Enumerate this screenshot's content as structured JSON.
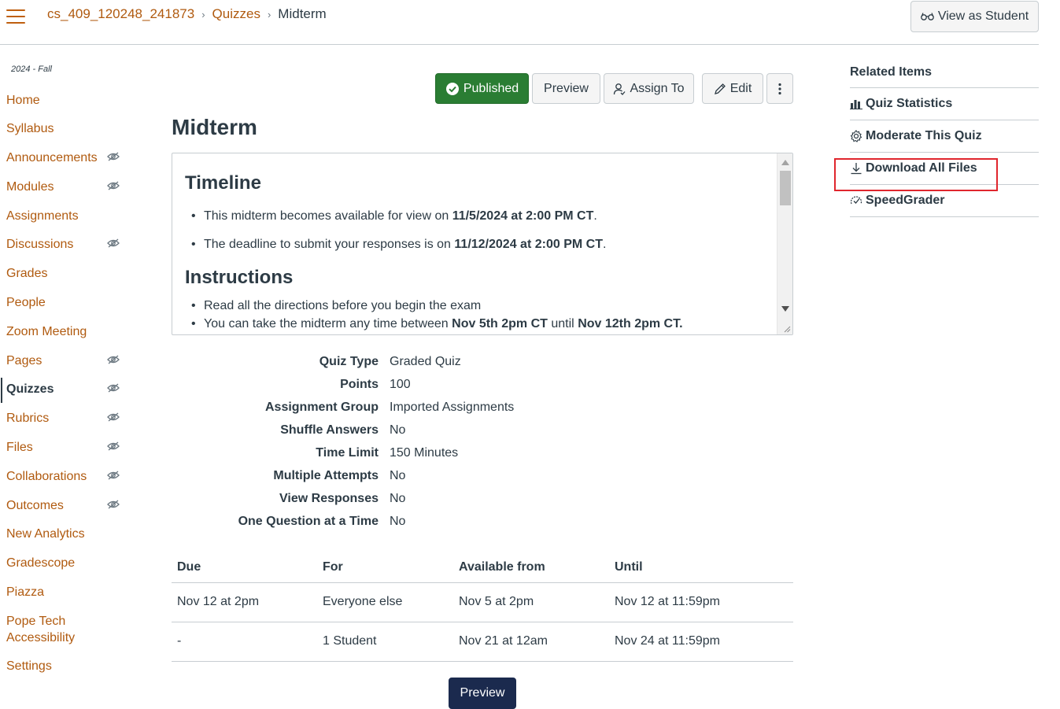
{
  "header": {
    "breadcrumb": [
      "cs_409_120248_241873",
      "Quizzes",
      "Midterm"
    ],
    "view_as_student": "View as Student"
  },
  "nav": {
    "term": "2024 - Fall",
    "items": [
      {
        "label": "Home",
        "hidden": false
      },
      {
        "label": "Syllabus",
        "hidden": false
      },
      {
        "label": "Announcements",
        "hidden": true
      },
      {
        "label": "Modules",
        "hidden": true
      },
      {
        "label": "Assignments",
        "hidden": false
      },
      {
        "label": "Discussions",
        "hidden": true
      },
      {
        "label": "Grades",
        "hidden": false
      },
      {
        "label": "People",
        "hidden": false
      },
      {
        "label": "Zoom Meeting",
        "hidden": false
      },
      {
        "label": "Pages",
        "hidden": true
      },
      {
        "label": "Quizzes",
        "hidden": true,
        "active": true
      },
      {
        "label": "Rubrics",
        "hidden": true
      },
      {
        "label": "Files",
        "hidden": true
      },
      {
        "label": "Collaborations",
        "hidden": true
      },
      {
        "label": "Outcomes",
        "hidden": true
      },
      {
        "label": "New Analytics",
        "hidden": false
      },
      {
        "label": "Gradescope",
        "hidden": false
      },
      {
        "label": "Piazza",
        "hidden": false
      },
      {
        "label": "Pope Tech",
        "label2": "Accessibility",
        "hidden": false
      },
      {
        "label": "Settings",
        "hidden": false
      }
    ]
  },
  "toolbar": {
    "published": "Published",
    "preview": "Preview",
    "assign_to": "Assign To",
    "edit": "Edit"
  },
  "quiz": {
    "title": "Midterm",
    "description": {
      "timeline_heading": "Timeline",
      "timeline_1_pre": "This midterm becomes available for view on ",
      "timeline_1_bold": "11/5/2024 at 2:00 PM CT",
      "timeline_1_post": ".",
      "timeline_2_pre": "The deadline to submit your responses is on ",
      "timeline_2_bold": "11/12/2024 at 2:00 PM CT",
      "timeline_2_post": ".",
      "instructions_heading": "Instructions",
      "instr_1": "Read all the directions before you begin the exam",
      "instr_2_pre": "You can take the midterm any time between ",
      "instr_2_bold1": "Nov 5th 2pm CT",
      "instr_2_mid": " until ",
      "instr_2_bold2": "Nov 12th 2pm CT."
    },
    "details": [
      {
        "label": "Quiz Type",
        "value": "Graded Quiz"
      },
      {
        "label": "Points",
        "value": "100"
      },
      {
        "label": "Assignment Group",
        "value": "Imported Assignments"
      },
      {
        "label": "Shuffle Answers",
        "value": "No"
      },
      {
        "label": "Time Limit",
        "value": "150 Minutes"
      },
      {
        "label": "Multiple Attempts",
        "value": "No"
      },
      {
        "label": "View Responses",
        "value": "No"
      },
      {
        "label": "One Question at a Time",
        "value": "No"
      }
    ],
    "due_table": {
      "headers": [
        "Due",
        "For",
        "Available from",
        "Until"
      ],
      "rows": [
        [
          "Nov 12 at 2pm",
          "Everyone else",
          "Nov 5 at 2pm",
          "Nov 12 at 11:59pm"
        ],
        [
          "-",
          "1 Student",
          "Nov 21 at 12am",
          "Nov 24 at 11:59pm"
        ]
      ]
    },
    "preview_bottom": "Preview"
  },
  "related": {
    "title": "Related Items",
    "items": [
      "Quiz Statistics",
      "Moderate This Quiz",
      "Download All Files",
      "SpeedGrader"
    ]
  },
  "colors": {
    "link": "#b05a0f",
    "published": "#2a7d33",
    "primary_dark": "#1b2a4e",
    "highlight": "#e0262d"
  }
}
